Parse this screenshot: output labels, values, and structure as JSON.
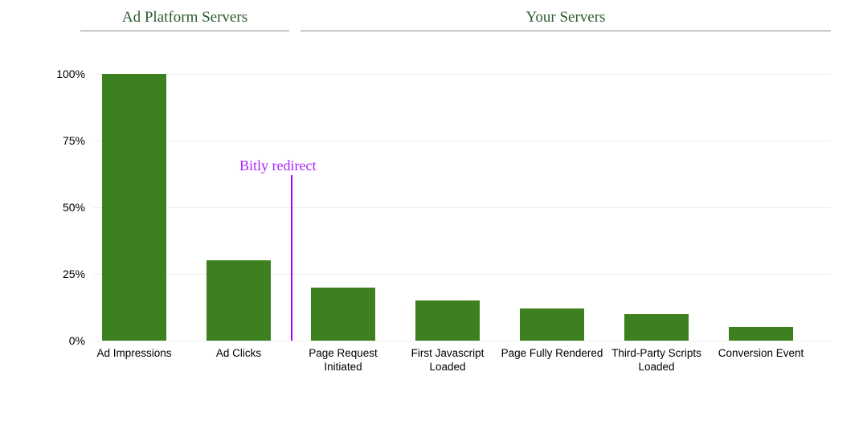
{
  "chart_data": {
    "type": "bar",
    "categories": [
      "Ad Impressions",
      "Ad Clicks",
      "Page Request Initiated",
      "First Javascript Loaded",
      "Page Fully Rendered",
      "Third-Party Scripts Loaded",
      "Conversion Event"
    ],
    "values": [
      100,
      30,
      20,
      15,
      12,
      10,
      5
    ],
    "ylim": [
      0,
      100
    ],
    "yticks": [
      0,
      25,
      50,
      75,
      100
    ],
    "ytick_labels": [
      "0%",
      "25%",
      "50%",
      "75%",
      "100%"
    ],
    "title": "",
    "xlabel": "",
    "ylabel": "",
    "bar_color": "#3d801f",
    "groups": [
      {
        "label": "Ad Platform Servers",
        "start_index": 0,
        "end_index": 1
      },
      {
        "label": "Your Servers",
        "start_index": 2,
        "end_index": 6
      }
    ],
    "annotation": {
      "text": "Bitly redirect",
      "between_index": [
        1,
        2
      ],
      "line_color": "#aa00ff",
      "text_color": "#aa22ff"
    }
  }
}
